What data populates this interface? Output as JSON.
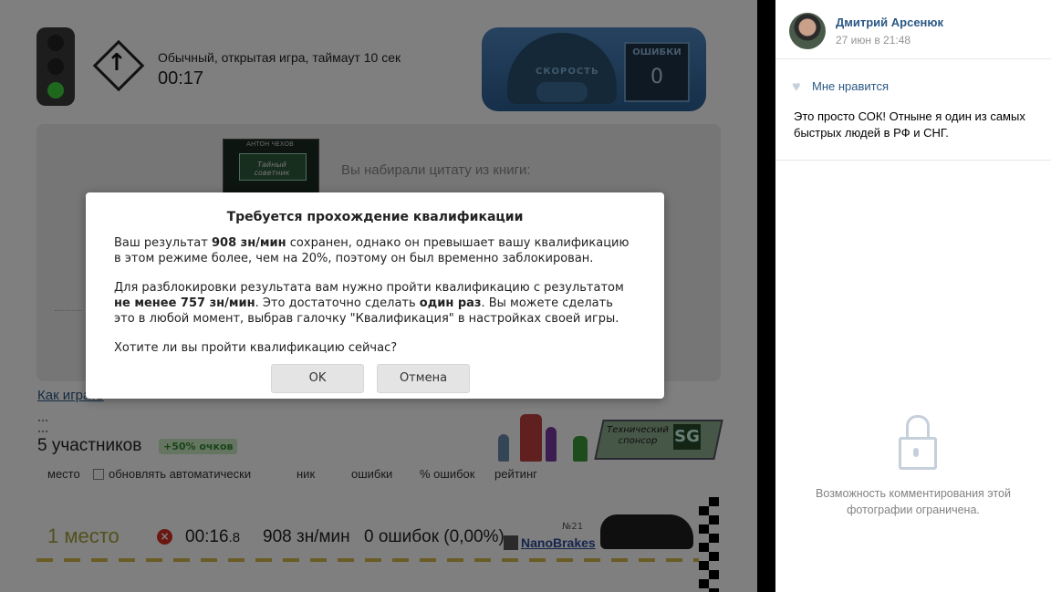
{
  "game": {
    "mode_text": "Обычный, открытая игра, таймаут 10 сек",
    "timer": "00:17",
    "speedometer_label": "СКОРОСТЬ",
    "errors_label": "ОШИБКИ",
    "errors_value": "0",
    "book_author": "АНТОН ЧЕХОВ",
    "book_title": "Тайный советник",
    "quote_intro": "Вы набирали цитату из книги:",
    "how_to_link": "Как играть",
    "participants": "5 участников",
    "bonus_badge": "+50% очков",
    "sponsor_text": "Технический спонсор",
    "sponsor_logo": "SG",
    "table_headers": {
      "place": "место",
      "auto_update": "обновлять автоматически",
      "nick": "ник",
      "errors": "ошибки",
      "error_pct": "% ошибок",
      "rating": "рейтинг"
    },
    "result_row": {
      "place": "1 место",
      "time_main": "00:16",
      "time_fraction": ".8",
      "speed": "908 зн/мин",
      "errors": "0 ошибок (0,00%)",
      "nick": "NanoBrakes",
      "rank": "№21"
    }
  },
  "dialog": {
    "title": "Требуется прохождение квалификации",
    "p1_a": "Ваш результат ",
    "p1_b": "908 зн/мин",
    "p1_c": " сохранен, однако он превышает вашу квалификацию в этом режиме более, чем на 20%, поэтому он был временно заблокирован.",
    "p2_a": "Для разблокировки результата вам нужно пройти квалификацию с результатом ",
    "p2_b": "не менее 757 зн/мин",
    "p2_c": ". Это достаточно сделать ",
    "p2_d": "один раз",
    "p2_e": ". Вы можете сделать это в любой момент, выбрав галочку \"Квалификация\" в настройках своей игры.",
    "p3": "Хотите ли вы пройти квалификацию сейчас?",
    "ok_label": "OK",
    "cancel_label": "Отмена"
  },
  "sidebar": {
    "author": "Дмитрий Арсенюк",
    "date": "27 июн в 21:48",
    "like_label": "Мне нравится",
    "post_text": "Это просто СОК! Отныне я один из самых быстрых людей в РФ и СНГ.",
    "comments_restricted": "Возможность комментирования этой фотографии ограничена."
  },
  "colors": {
    "link": "#2a5885",
    "overlay": "rgba(0,0,0,0.5)",
    "place_text": "#a3a33a"
  }
}
